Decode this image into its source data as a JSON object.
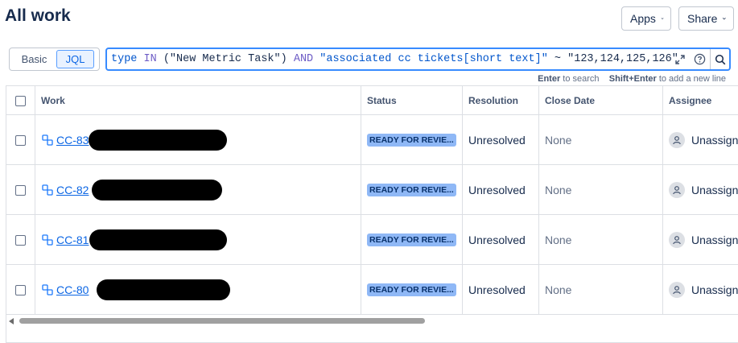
{
  "page": {
    "title": "All work"
  },
  "header": {
    "apps_label": "Apps",
    "share_label": "Share"
  },
  "search": {
    "mode_basic": "Basic",
    "mode_jql": "JQL",
    "active_mode": "JQL",
    "query_parts": {
      "p1": "type",
      "p2": " IN ",
      "p3": "(\"New Metric Task\") ",
      "p4": "AND",
      "p5": " \"associated cc tickets[short text]\"",
      "p6": " ~ ",
      "p7": "\"123,124,125,126\""
    },
    "hint_enter_key": "Enter",
    "hint_enter_text": " to search",
    "hint_shift_key": "Shift+Enter",
    "hint_shift_text": " to add a new line"
  },
  "table": {
    "columns": [
      "Work",
      "Status",
      "Resolution",
      "Close Date",
      "Assignee"
    ],
    "rows": [
      {
        "key": "CC-83",
        "status": "READY FOR REVIE...",
        "resolution": "Unresolved",
        "close_date": "None",
        "assignee": "Unassigned"
      },
      {
        "key": "CC-82",
        "status": "READY FOR REVIE...",
        "resolution": "Unresolved",
        "close_date": "None",
        "assignee": "Unassigned"
      },
      {
        "key": "CC-81",
        "status": "READY FOR REVIE...",
        "resolution": "Unresolved",
        "close_date": "None",
        "assignee": "Unassigned"
      },
      {
        "key": "CC-80",
        "status": "READY FOR REVIE...",
        "resolution": "Unresolved",
        "close_date": "None",
        "assignee": "Unassigned"
      }
    ]
  },
  "icons": {
    "apps_chevron": "chevron-down-icon",
    "share_chevron": "chevron-down-icon",
    "expand": "expand-icon",
    "help": "help-icon",
    "search": "search-icon",
    "work_type": "subtask-icon",
    "assignee_avatar": "user-icon"
  },
  "colors": {
    "accent": "#0c66e4",
    "status_lozenge": "#8fb8f6",
    "query_border": "#388bff"
  }
}
